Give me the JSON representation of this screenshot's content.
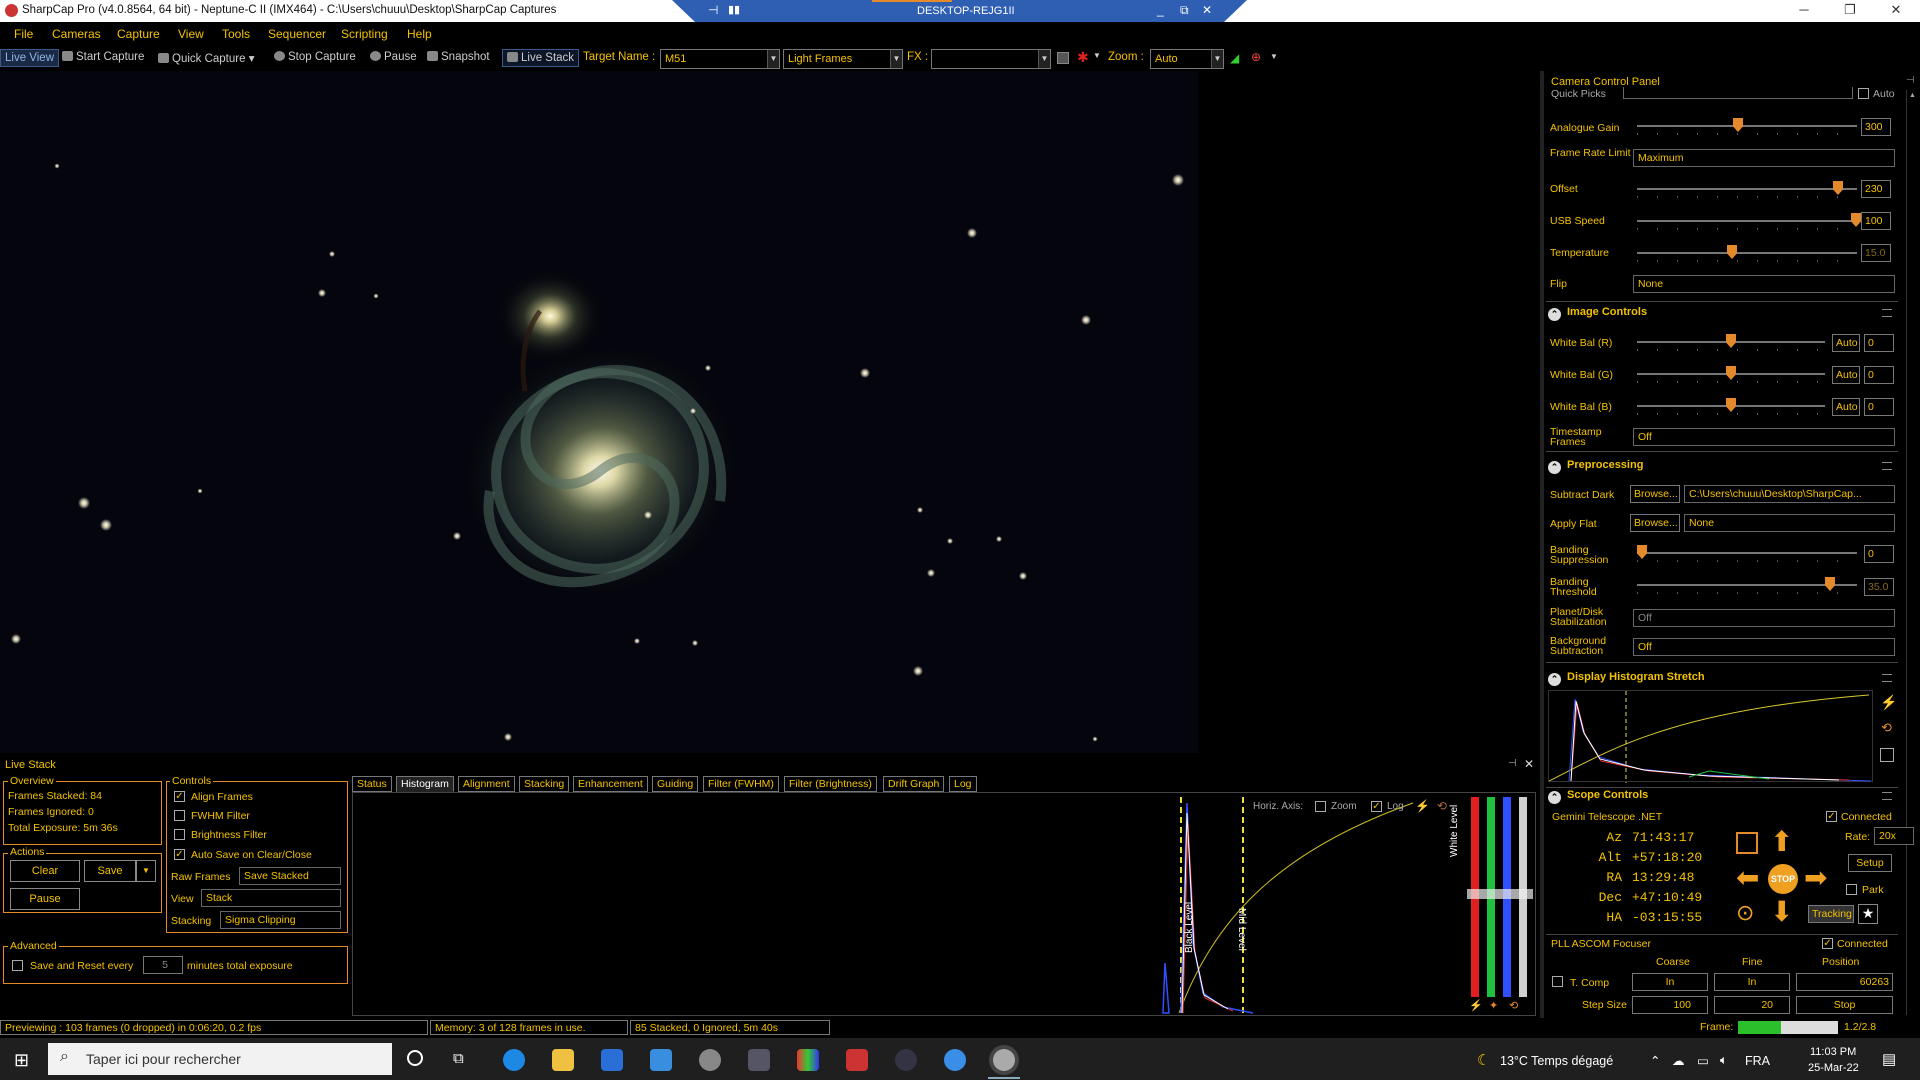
{
  "window": {
    "title": "SharpCap Pro (v4.0.8564, 64 bit) - Neptune-C II (IMX464) - C:\\Users\\chuuu\\Desktop\\SharpCap Captures",
    "remote_host": "DESKTOP-REJG1II"
  },
  "menu": [
    "File",
    "Cameras",
    "Capture",
    "View",
    "Tools",
    "Sequencer",
    "Scripting",
    "Help"
  ],
  "toolbar": {
    "live_view": "Live View",
    "start_capture": "Start Capture",
    "quick_capture": "Quick Capture",
    "stop_capture": "Stop Capture",
    "pause": "Pause",
    "snapshot": "Snapshot",
    "live_stack": "Live Stack",
    "target_name_label": "Target Name :",
    "target_name_value": "M51",
    "frame_type": "Light Frames",
    "fx_label": "FX :",
    "fx_value": "",
    "zoom_label": "Zoom :",
    "zoom_value": "Auto"
  },
  "camera_panel": {
    "title": "Camera Control Panel",
    "quick_picks_label": "Quick Picks",
    "auto_label": "Auto",
    "analogue_gain": {
      "label": "Analogue Gain",
      "value": "300",
      "level": 0.46
    },
    "frame_rate": {
      "label": "Frame Rate Limit",
      "value": "Maximum"
    },
    "offset": {
      "label": "Offset",
      "value": "230",
      "level": 0.92
    },
    "usb_speed": {
      "label": "USB Speed",
      "value": "100",
      "level": 1.0
    },
    "temperature": {
      "label": "Temperature",
      "value": "15.0",
      "level": 0.43
    },
    "flip": {
      "label": "Flip",
      "value": "None"
    }
  },
  "image_controls": {
    "title": "Image Controls",
    "wb_r": {
      "label": "White Bal (R)",
      "auto": "Auto",
      "value": "0",
      "level": 0.5
    },
    "wb_g": {
      "label": "White Bal (G)",
      "auto": "Auto",
      "value": "0",
      "level": 0.5
    },
    "wb_b": {
      "label": "White Bal (B)",
      "auto": "Auto",
      "value": "0",
      "level": 0.5
    },
    "timestamp": {
      "label": "Timestamp Frames",
      "value": "Off"
    }
  },
  "preprocessing": {
    "title": "Preprocessing",
    "subtract_dark": {
      "label": "Subtract Dark",
      "browse": "Browse...",
      "value": "C:\\Users\\chuuu\\Desktop\\SharpCap..."
    },
    "apply_flat": {
      "label": "Apply Flat",
      "browse": "Browse...",
      "value": "None"
    },
    "banding_suppression": {
      "label": "Banding Suppression",
      "value": "0",
      "level": 0.0
    },
    "banding_threshold": {
      "label": "Banding Threshold",
      "value": "35.0",
      "level": 0.88
    },
    "planet_stab": {
      "label": "Planet/Disk Stabilization",
      "value": "Off"
    },
    "background_sub": {
      "label": "Background Subtraction",
      "value": "Off"
    }
  },
  "histogram_stretch": {
    "title": "Display Histogram Stretch"
  },
  "scope": {
    "title": "Scope Controls",
    "driver": "Gemini Telescope .NET",
    "connected_label": "Connected",
    "az_label": "Az",
    "az": "71:43:17",
    "alt_label": "Alt",
    "alt": "+57:18:20",
    "ra_label": "RA",
    "ra": "13:29:48",
    "dec_label": "Dec",
    "dec": "+47:10:49",
    "ha_label": "HA",
    "ha": "-03:15:55",
    "rate_label": "Rate:",
    "rate_value": "20x",
    "setup": "Setup",
    "park": "Park",
    "tracking": "Tracking",
    "stop": "STOP"
  },
  "focuser": {
    "title": "PLL ASCOM Focuser",
    "connected_label": "Connected",
    "coarse": "Coarse",
    "fine": "Fine",
    "position": "Position",
    "tcomp": "T. Comp",
    "in_coarse": "In",
    "in_fine": "In",
    "position_value": "60263",
    "step_size_label": "Step Size",
    "step_coarse": "100",
    "step_fine": "20",
    "stop": "Stop",
    "frame_label": "Frame:",
    "frame_value": "1.2/2.8"
  },
  "live_stack": {
    "title": "Live Stack",
    "overview_title": "Overview",
    "frames_stacked": "Frames Stacked:  84",
    "frames_ignored": "Frames Ignored:  0",
    "total_exposure": "Total Exposure:  5m 36s",
    "actions_title": "Actions",
    "clear": "Clear",
    "save": "Save",
    "pause": "Pause",
    "controls_title": "Controls",
    "align_frames": "Align Frames",
    "fwhm_filter": "FWHM Filter",
    "brightness_filter": "Brightness Filter",
    "auto_save": "Auto Save on Clear/Close",
    "raw_frames_label": "Raw Frames",
    "raw_frames_value": "Save Stacked",
    "view_label": "View",
    "view_value": "Stack",
    "stacking_label": "Stacking",
    "stacking_value": "Sigma Clipping",
    "advanced_title": "Advanced",
    "save_reset": "Save and Reset every",
    "minutes_value": "5",
    "minutes_label": "minutes total exposure",
    "tabs": [
      "Status",
      "Histogram",
      "Alignment",
      "Stacking",
      "Enhancement",
      "Guiding",
      "Filter (FWHM)",
      "Filter (Brightness)",
      "Drift Graph",
      "Log"
    ],
    "horiz_axis": "Horiz. Axis:",
    "zoom": "Zoom",
    "log": "Log",
    "black_level": "Black Level",
    "mid_level": "Mid Level",
    "white_level": "White Level"
  },
  "status": {
    "preview": "Previewing : 103 frames (0 dropped) in 0:06:20, 0.2 fps",
    "memory": "Memory: 3 of 128 frames in use.",
    "stacked": "85 Stacked, 0 Ignored, 5m 40s"
  },
  "taskbar": {
    "search_placeholder": "Taper ici pour rechercher",
    "weather": "13°C  Temps dégagé",
    "lang": "FRA",
    "time": "11:03 PM",
    "date": "25-Mar-22"
  }
}
